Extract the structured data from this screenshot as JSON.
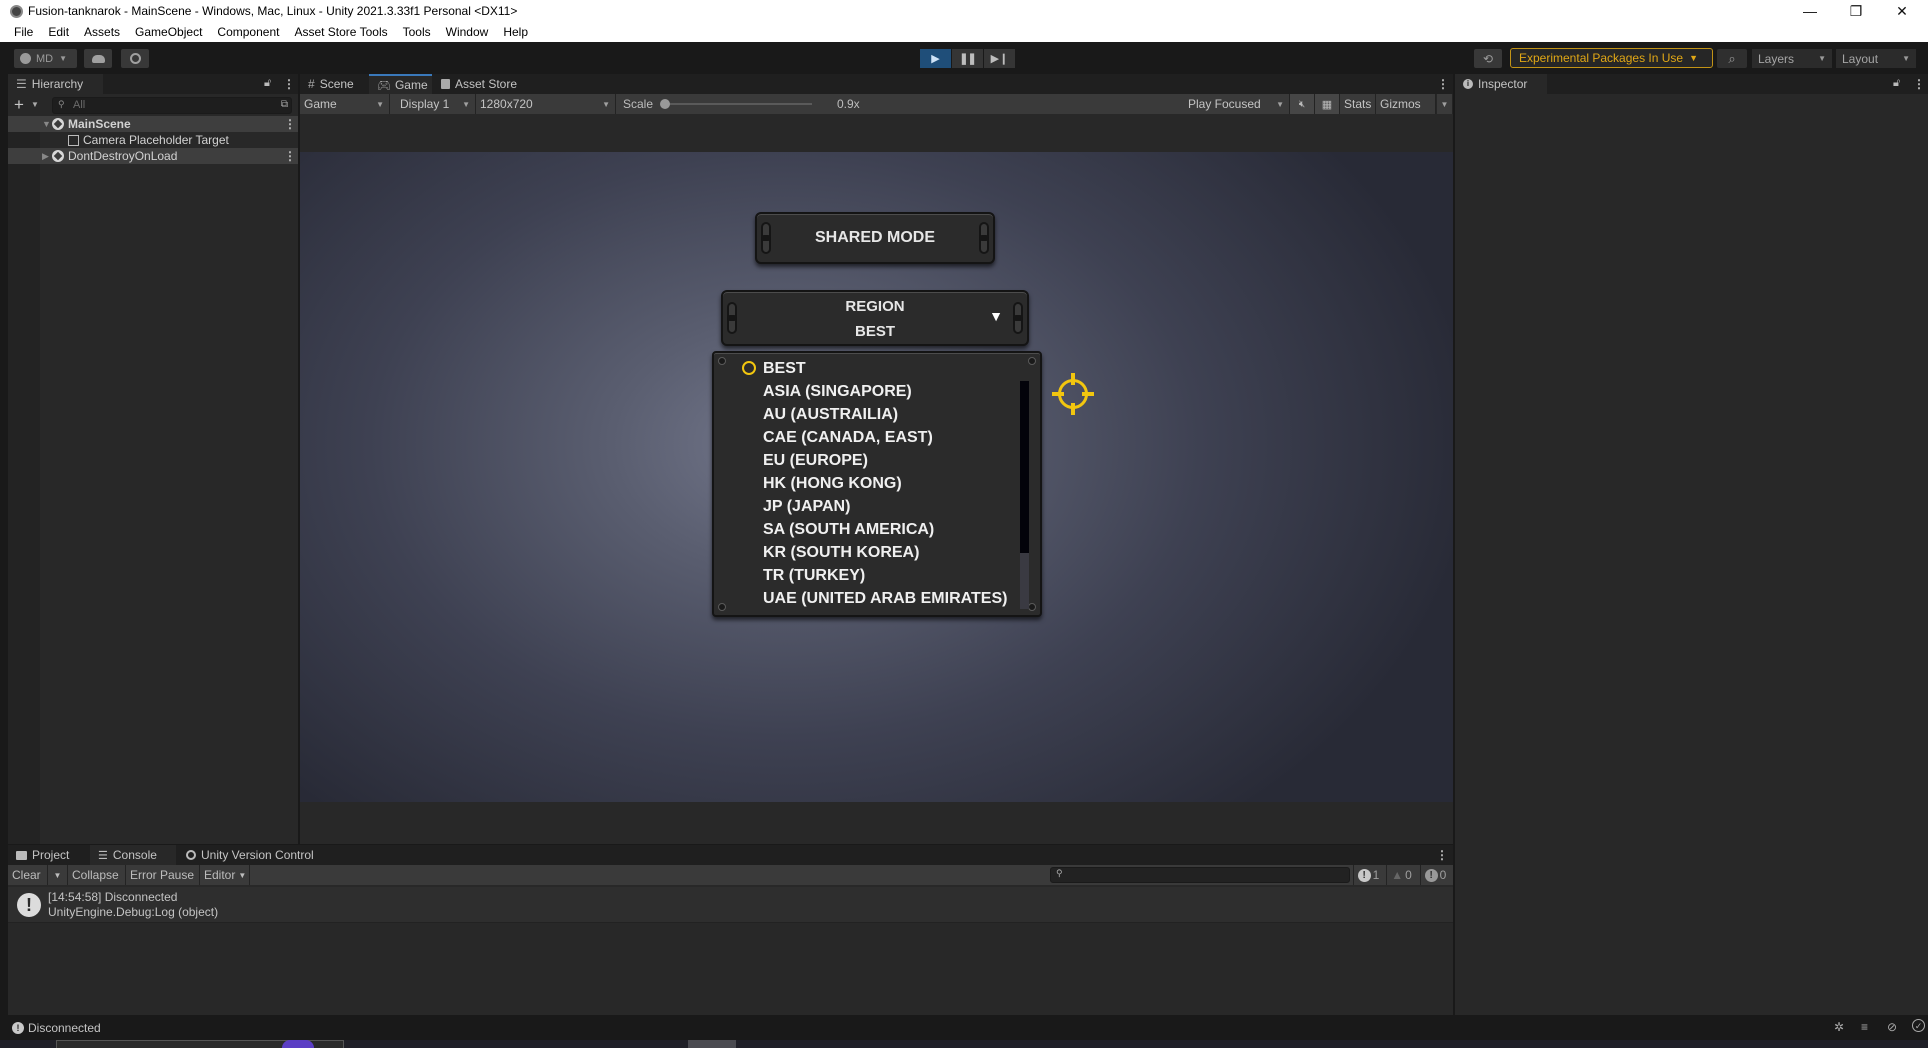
{
  "window": {
    "title": "Fusion-tanknarok - MainScene - Windows, Mac, Linux - Unity 2021.3.33f1 Personal <DX11>",
    "controls": {
      "minimize": "—",
      "restore": "❐",
      "close": "✕"
    }
  },
  "menu": [
    "File",
    "Edit",
    "Assets",
    "GameObject",
    "Component",
    "Asset Store Tools",
    "Tools",
    "Window",
    "Help"
  ],
  "toolbar": {
    "account_label": "MD",
    "play_state": "playing",
    "experimental_label": "Experimental Packages In Use",
    "layers_label": "Layers",
    "layout_label": "Layout",
    "accent_color": "#e0a716"
  },
  "hierarchy": {
    "tab_label": "Hierarchy",
    "search_placeholder": "All",
    "items": [
      {
        "label": "MainScene",
        "type": "scene",
        "expanded": true
      },
      {
        "label": "Camera Placeholder Target",
        "type": "gameobject"
      },
      {
        "label": "DontDestroyOnLoad",
        "type": "scene",
        "expanded": false
      }
    ]
  },
  "game_panel": {
    "tabs": [
      {
        "label": "Scene",
        "icon": "grid-icon"
      },
      {
        "label": "Game",
        "icon": "gamepad-icon",
        "active": true
      },
      {
        "label": "Asset Store",
        "icon": "shopping-bag-icon"
      }
    ],
    "view_mode": "Game",
    "display": "Display 1",
    "resolution": "1280x720",
    "scale_label": "Scale",
    "scale_value": "0.9x",
    "play_mode_option": "Play Focused",
    "stats_label": "Stats",
    "gizmos_label": "Gizmos"
  },
  "game_ui": {
    "shared_mode_button": "SHARED MODE",
    "region_title": "REGION",
    "region_selected": "BEST",
    "region_options": [
      "BEST",
      "ASIA (SINGAPORE)",
      "AU (AUSTRAILIA)",
      "CAE (CANADA, EAST)",
      "EU (EUROPE)",
      "HK (HONG KONG)",
      "JP (JAPAN)",
      "SA (SOUTH AMERICA)",
      "KR (SOUTH KOREA)",
      "TR (TURKEY)",
      "UAE (UNITED ARAB EMIRATES)"
    ],
    "highlight_color": "#f2c60f"
  },
  "inspector": {
    "tab_label": "Inspector"
  },
  "console": {
    "tabs": [
      {
        "label": "Project",
        "icon": "folder-icon"
      },
      {
        "label": "Console",
        "icon": "console-icon",
        "active": true
      },
      {
        "label": "Unity Version Control",
        "icon": "version-control-icon"
      }
    ],
    "buttons": {
      "clear": "Clear",
      "collapse": "Collapse",
      "error_pause": "Error Pause",
      "editor": "Editor"
    },
    "counts": {
      "log": "1",
      "warning": "0",
      "error": "0"
    },
    "entries": [
      {
        "line1": "[14:54:58] Disconnected",
        "line2": "UnityEngine.Debug:Log (object)"
      }
    ]
  },
  "statusbar": {
    "message": "Disconnected"
  }
}
